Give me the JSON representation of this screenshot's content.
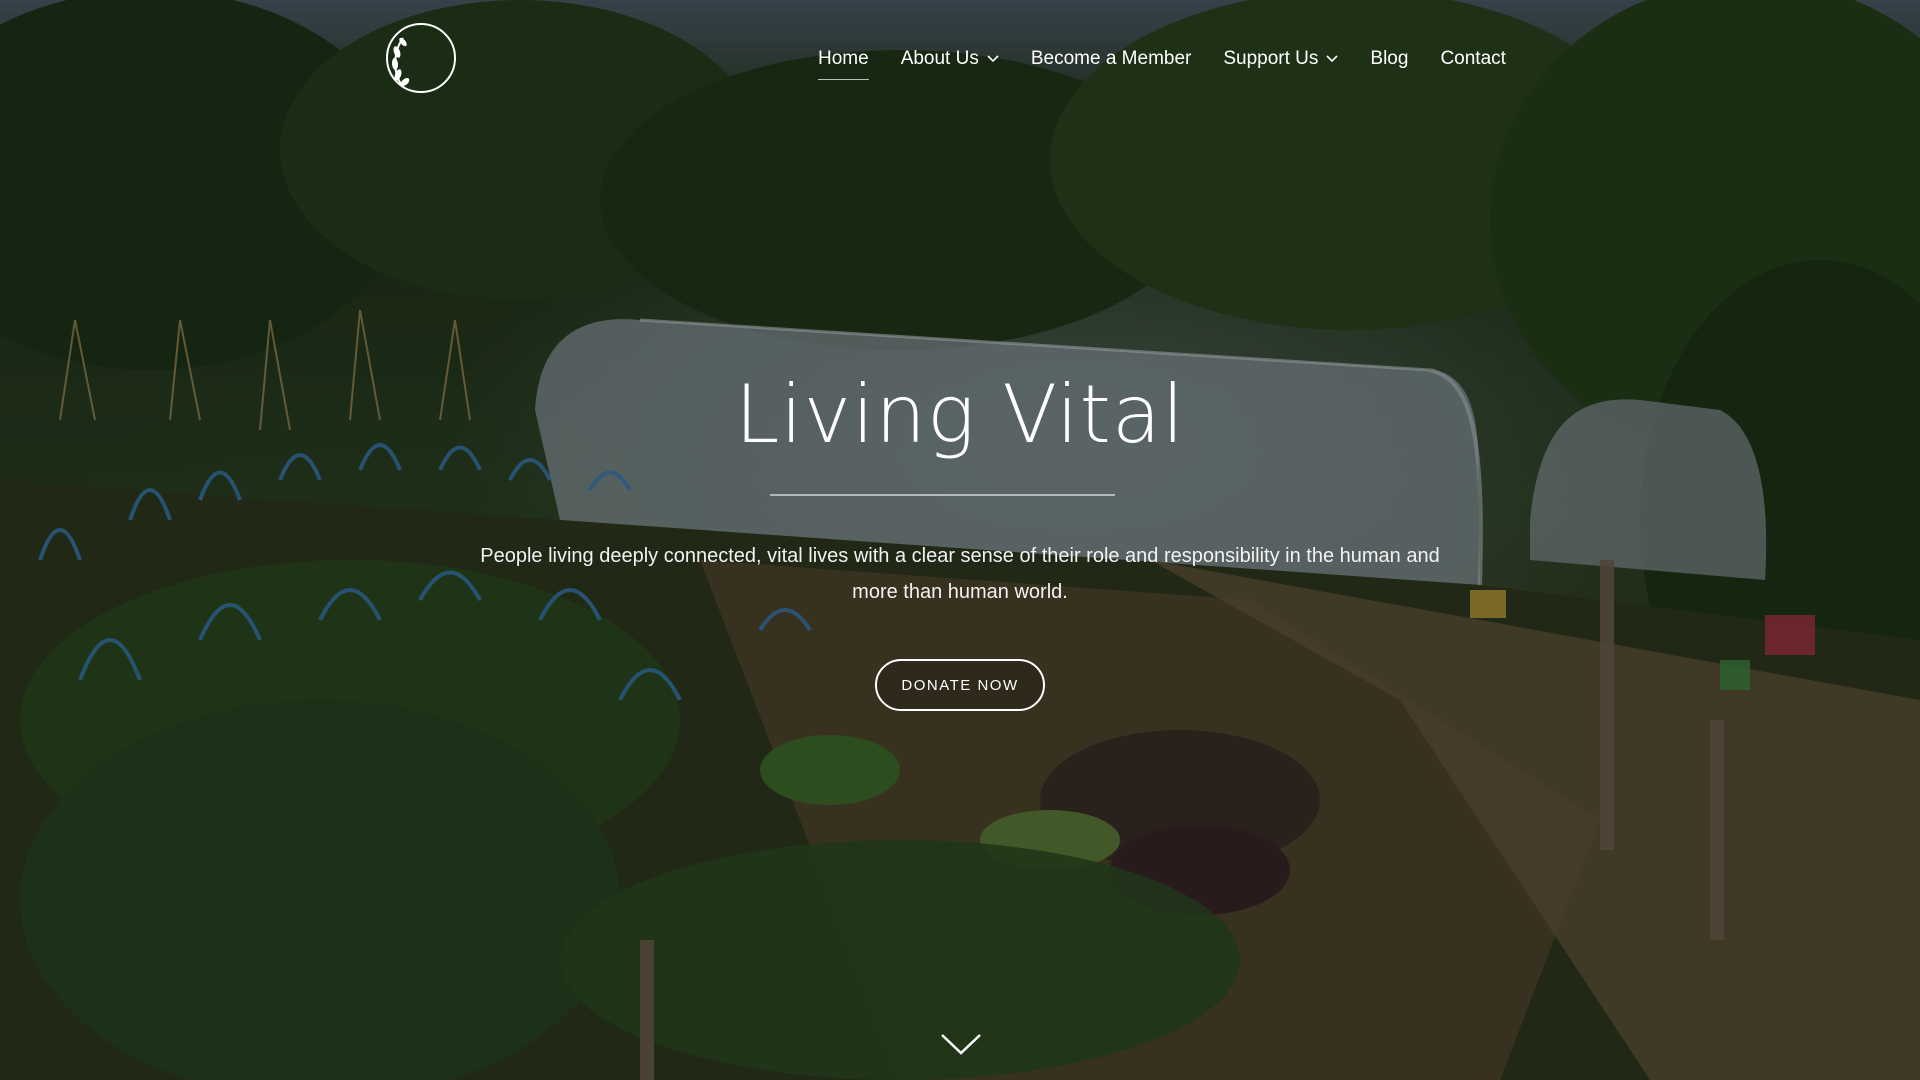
{
  "brand": {
    "logo_text": "Living Vital",
    "logo_icon": "leaf-wreath-icon"
  },
  "nav": {
    "items": [
      {
        "label": "Home",
        "active": true,
        "has_dropdown": false
      },
      {
        "label": "About Us",
        "active": false,
        "has_dropdown": true
      },
      {
        "label": "Become a Member",
        "active": false,
        "has_dropdown": false
      },
      {
        "label": "Support Us",
        "active": false,
        "has_dropdown": true
      },
      {
        "label": "Blog",
        "active": false,
        "has_dropdown": false
      },
      {
        "label": "Contact",
        "active": false,
        "has_dropdown": false
      }
    ]
  },
  "hero": {
    "title": "Living Vital",
    "subtitle": "People living deeply connected, vital lives with a clear sense of their role and responsibility in the human and more than human world.",
    "cta_label": "DONATE NOW",
    "scroll_icon": "chevron-down-icon",
    "background": "garden-polytunnel-photo"
  },
  "colors": {
    "text": "#ffffff",
    "overlay": "rgba(0,0,0,0.28)"
  }
}
